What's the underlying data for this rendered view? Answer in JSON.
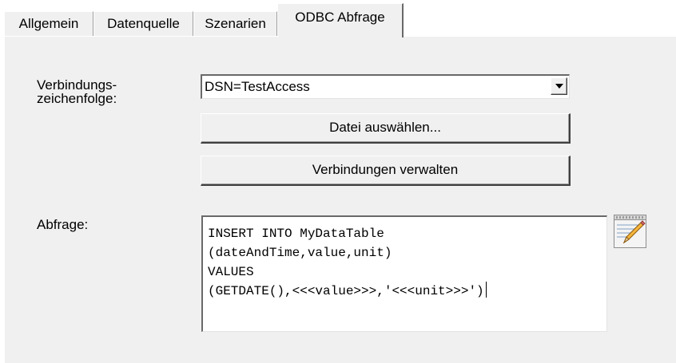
{
  "tabs": [
    {
      "label": "Allgemein",
      "active": false
    },
    {
      "label": "Datenquelle",
      "active": false
    },
    {
      "label": "Szenarien",
      "active": false
    },
    {
      "label": "ODBC Abfrage",
      "active": true
    }
  ],
  "connection": {
    "label_line1": "Verbindungs-",
    "label_line2": "zeichenfolge:",
    "value": "DSN=TestAccess"
  },
  "buttons": {
    "select_file": "Datei auswählen...",
    "manage_connections": "Verbindungen verwalten"
  },
  "query": {
    "label": "Abfrage:",
    "text": "INSERT INTO MyDataTable\n(dateAndTime,value,unit)\nVALUES\n(GETDATE(),<<<value>>>,'<<<unit>>>')"
  },
  "icons": {
    "dropdown": "chevron-down-icon",
    "query_editor": "notepad-edit-icon"
  }
}
